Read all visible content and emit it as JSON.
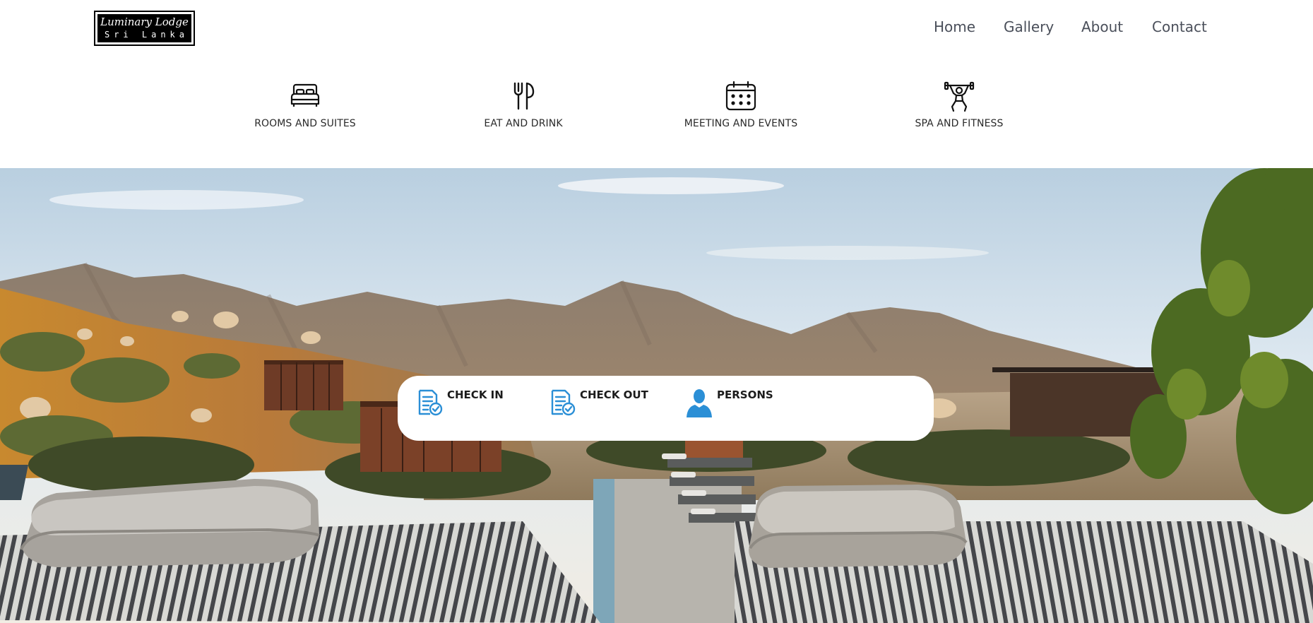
{
  "logo": {
    "line1": "Luminary Lodge",
    "line2": "Sri Lanka"
  },
  "nav": {
    "items": [
      {
        "label": "Home"
      },
      {
        "label": "Gallery"
      },
      {
        "label": "About"
      },
      {
        "label": "Contact"
      }
    ]
  },
  "features": [
    {
      "label": "ROOMS AND SUITES",
      "icon": "bed-icon"
    },
    {
      "label": "EAT AND DRINK",
      "icon": "fork-knife-icon"
    },
    {
      "label": "MEETING AND EVENTS",
      "icon": "calendar-icon"
    },
    {
      "label": "SPA AND FITNESS",
      "icon": "weightlifter-icon"
    }
  ],
  "booking": {
    "check_in": "CHECK IN",
    "check_out": "CHECK OUT",
    "persons": "PERSONS"
  },
  "colors": {
    "accent": "#2b8fd6",
    "nav_text": "#4a4f5a",
    "logo_bg": "#000000"
  }
}
